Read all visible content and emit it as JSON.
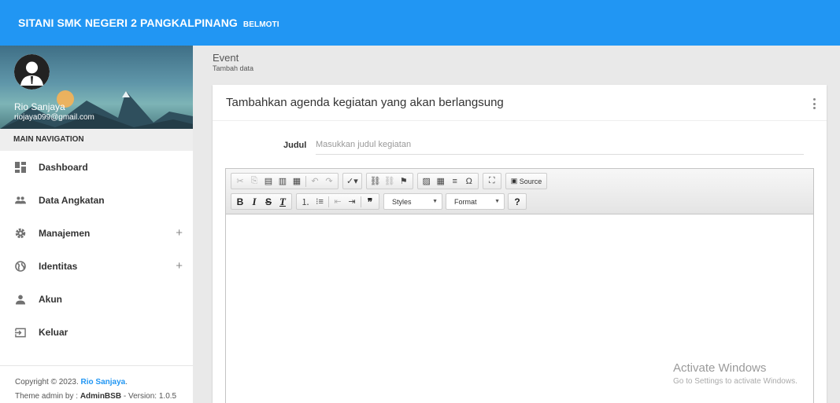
{
  "topbar": {
    "title": "SITANI SMK NEGERI 2 PANGKALPINANG",
    "subtitle": "BELMOTI"
  },
  "user": {
    "name": "Rio Sanjaya",
    "email": "riojaya099@gmail.com"
  },
  "nav": {
    "header": "MAIN NAVIGATION",
    "items": [
      {
        "label": "Dashboard",
        "icon": "dashboard-icon"
      },
      {
        "label": "Data Angkatan",
        "icon": "people-icon"
      },
      {
        "label": "Manajemen",
        "icon": "gear-icon",
        "expand": "+"
      },
      {
        "label": "Identitas",
        "icon": "globe-icon",
        "expand": "+"
      },
      {
        "label": "Akun",
        "icon": "person-icon"
      },
      {
        "label": "Keluar",
        "icon": "logout-icon"
      }
    ]
  },
  "footer": {
    "copyright_prefix": "Copyright © 2023.",
    "copyright_name": "Rio Sanjaya",
    "copyright_suffix": ".",
    "theme_prefix": "Theme admin by :",
    "theme_name": "AdminBSB",
    "theme_suffix": "- Version: 1.0.5"
  },
  "page": {
    "title": "Event",
    "subtitle": "Tambah data"
  },
  "card": {
    "title": "Tambahkan agenda kegiatan yang akan berlangsung"
  },
  "form": {
    "judul_label": "Judul",
    "judul_value": "",
    "judul_placeholder": "Masukkan judul kegiatan"
  },
  "editor": {
    "source_label": "Source",
    "styles_label": "Styles",
    "format_label": "Format",
    "help_label": "?",
    "content": ""
  },
  "watermark": {
    "line1": "Activate Windows",
    "line2": "Go to Settings to activate Windows."
  },
  "colors": {
    "accent": "#2196f3",
    "sidebar_bg": "#ffffff",
    "page_bg": "#e9e9e9"
  }
}
